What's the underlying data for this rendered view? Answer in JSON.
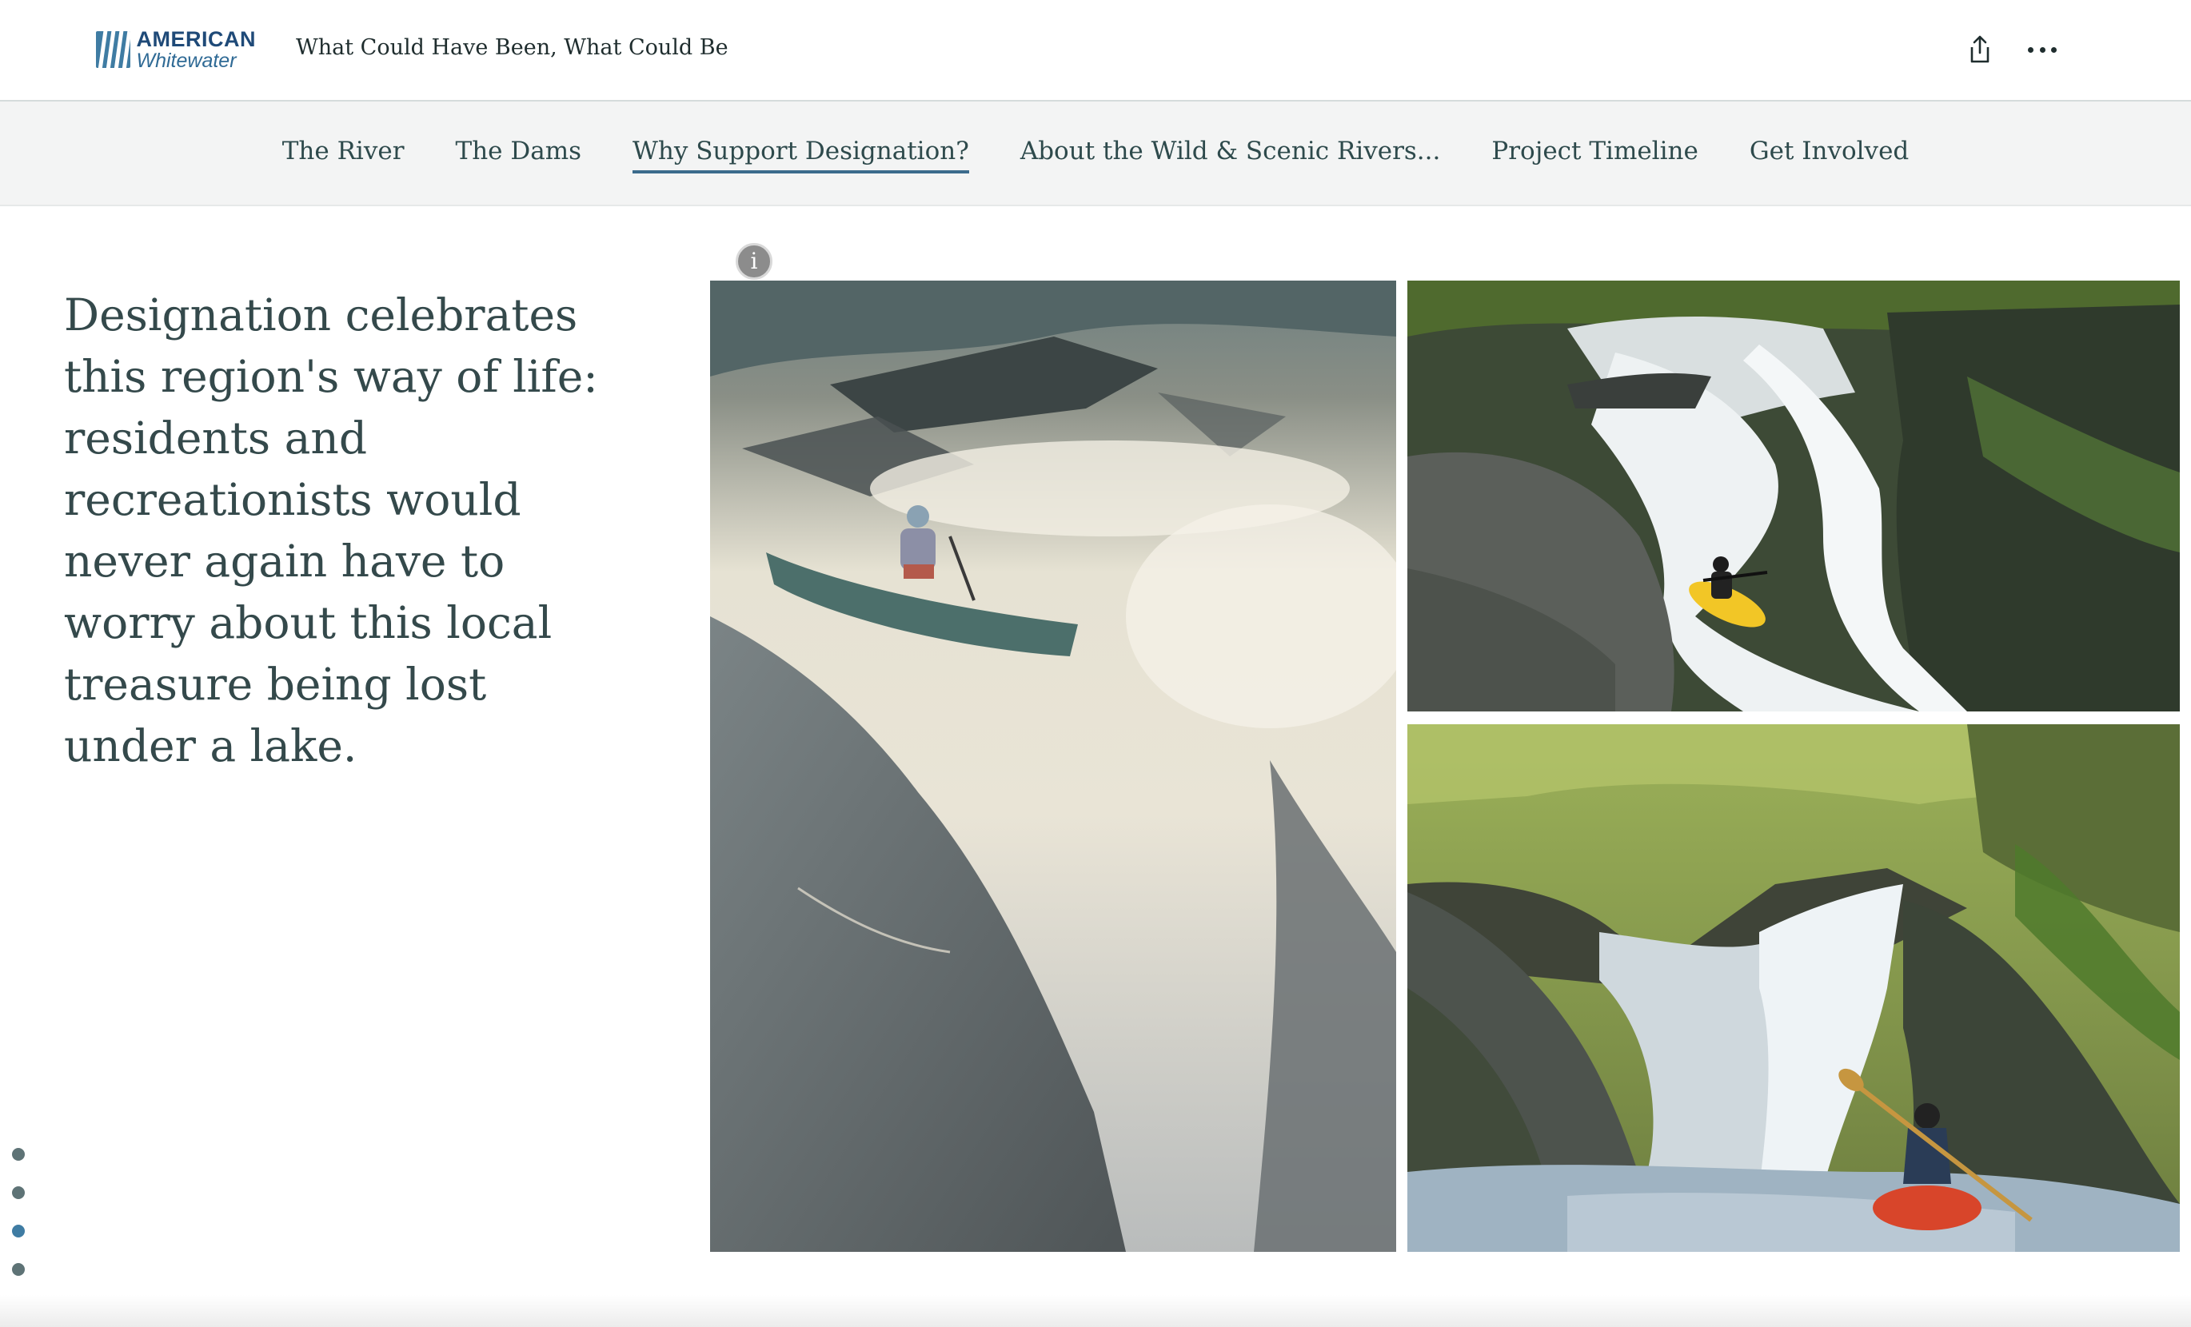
{
  "header": {
    "logo_alt": "American Whitewater",
    "logo_top": "AMERICAN",
    "logo_bottom": "Whitewater",
    "story_title": "What Could Have Been, What Could Be",
    "share_icon": "share-icon",
    "more_icon": "more-options-icon"
  },
  "nav": {
    "items": [
      {
        "label": "The River",
        "active": false
      },
      {
        "label": "The Dams",
        "active": false
      },
      {
        "label": "Why Support Designation?",
        "active": true
      },
      {
        "label": "About the Wild & Scenic Rivers...",
        "active": false
      },
      {
        "label": "Project Timeline",
        "active": false
      },
      {
        "label": "Get Involved",
        "active": false
      }
    ]
  },
  "main": {
    "quote": "Designation celebrates this region's way of life: residents and recreationists would never again have to worry about this local treasure being lost under a lake.",
    "info_glyph": "i",
    "images": [
      {
        "name": "canoe-paddler-rapids-photo"
      },
      {
        "name": "yellow-kayak-waterfall-photo"
      },
      {
        "name": "red-kayak-waterfall-photo"
      }
    ]
  },
  "side_nav": {
    "dot_count": 4,
    "active_index": 2
  },
  "colors": {
    "accent": "#3b6b8c",
    "text": "#34494b",
    "nav_bg": "#f3f4f4"
  }
}
